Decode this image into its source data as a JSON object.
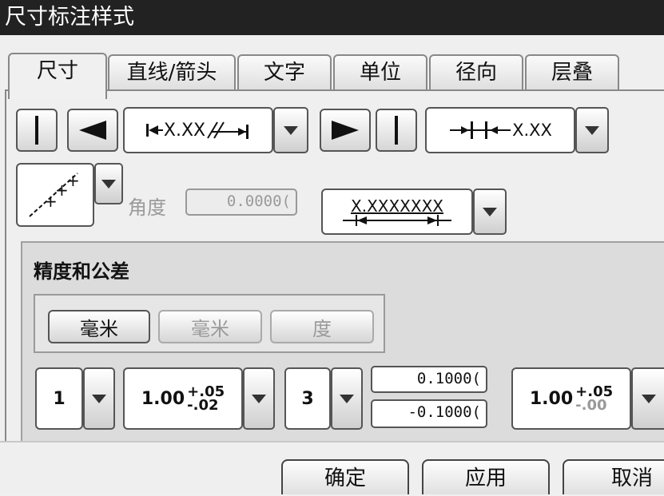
{
  "window": {
    "title": "尺寸标注样式"
  },
  "tabs": [
    {
      "label": "尺寸",
      "active": true
    },
    {
      "label": "直线/箭头"
    },
    {
      "label": "文字"
    },
    {
      "label": "单位"
    },
    {
      "label": "径向"
    },
    {
      "label": "层叠"
    }
  ],
  "dimension": {
    "text_placement_sample": "X.XX",
    "ordinate_sample": "X.XX",
    "angle_label": "角度",
    "angle_value": "0.0000(",
    "text_orientation_sample": "X.XXXXXXX"
  },
  "precision": {
    "title": "精度和公差",
    "unit_buttons": [
      {
        "label": "毫米",
        "enabled": true
      },
      {
        "label": "毫米",
        "enabled": false
      },
      {
        "label": "度",
        "enabled": false
      }
    ],
    "precision_value": "1",
    "tolerance_base": "1.00",
    "tolerance_upper": "+.05",
    "tolerance_lower": "-.02",
    "tolerance_precision": "3",
    "upper_limit": "0.1000(",
    "lower_limit": "-0.1000(",
    "secondary_base": "1.00",
    "secondary_upper": "+.05",
    "secondary_lower": "-.00"
  },
  "buttons": {
    "ok": "确定",
    "apply": "应用",
    "cancel": "取消"
  }
}
